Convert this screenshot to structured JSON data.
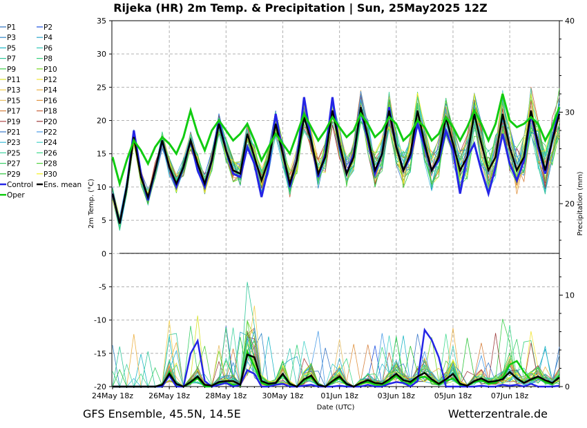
{
  "title": "Rijeka  (HR)  2m Temp. & Precipitation | Sun, 25May2025 12Z",
  "footer_left": "GFS Ensemble, 45.5N, 14.5E",
  "footer_right": "Wetterzentrale.de",
  "chart_data": {
    "type": "line",
    "title": "Rijeka  (HR)  2m Temp. & Precipitation | Sun, 25May2025 12Z",
    "xlabel": "Date (UTC)",
    "ylabel_left": "2m Temp. (°C)",
    "ylabel_right": "Precipitation (mm)",
    "ylim_left": [
      -20,
      35
    ],
    "ylim_right": [
      0,
      40
    ],
    "yticks_left": [
      "35",
      "30",
      "25",
      "20",
      "15",
      "10",
      "5",
      "0",
      "-5",
      "-10",
      "-15",
      "-20"
    ],
    "yticks_right": [
      "40",
      "30",
      "20",
      "10",
      "0"
    ],
    "xticks": [
      "24May 18z",
      "26May 18z",
      "28May 18z",
      "30May 18z",
      "01Jun 18z",
      "03Jun 18z",
      "05Jun 18z",
      "07Jun 18z"
    ],
    "x_step": "6h",
    "grid": true,
    "legend": "left outside",
    "legend_entries": [
      {
        "name": "P1",
        "color": "#2a6fbd"
      },
      {
        "name": "P2",
        "color": "#1a4fe0"
      },
      {
        "name": "P3",
        "color": "#2f86c8"
      },
      {
        "name": "P4",
        "color": "#2aa5c9"
      },
      {
        "name": "P5",
        "color": "#1cb6c6"
      },
      {
        "name": "P6",
        "color": "#2fc7b6"
      },
      {
        "name": "P7",
        "color": "#2fc79a"
      },
      {
        "name": "P8",
        "color": "#31d07a"
      },
      {
        "name": "P9",
        "color": "#3acd4a"
      },
      {
        "name": "P10",
        "color": "#74d822"
      },
      {
        "name": "P11",
        "color": "#d8e22a"
      },
      {
        "name": "P12",
        "color": "#f2e531"
      },
      {
        "name": "P13",
        "color": "#f2cf4f"
      },
      {
        "name": "P14",
        "color": "#ecb143"
      },
      {
        "name": "P15",
        "color": "#e8c067"
      },
      {
        "name": "P16",
        "color": "#e09340"
      },
      {
        "name": "P17",
        "color": "#d6813f"
      },
      {
        "name": "P18",
        "color": "#c7623e"
      },
      {
        "name": "P19",
        "color": "#b04a4a"
      },
      {
        "name": "P20",
        "color": "#9c3b3b"
      },
      {
        "name": "P21",
        "color": "#3a78c8"
      },
      {
        "name": "P22",
        "color": "#4a9be6"
      },
      {
        "name": "P23",
        "color": "#3bbbd8"
      },
      {
        "name": "P24",
        "color": "#47d2c8"
      },
      {
        "name": "P25",
        "color": "#41d4a0"
      },
      {
        "name": "P26",
        "color": "#3fd98c"
      },
      {
        "name": "P27",
        "color": "#39cf66"
      },
      {
        "name": "P28",
        "color": "#52d13e"
      },
      {
        "name": "P29",
        "color": "#2cc43a"
      },
      {
        "name": "P30",
        "color": "#f5f01c"
      },
      {
        "name": "Control",
        "color": "#2525e6"
      },
      {
        "name": "Ens. mean",
        "color": "#000000"
      },
      {
        "name": "Oper",
        "color": "#11cc11"
      }
    ],
    "series": [
      {
        "name": "Ens. mean",
        "axis": "left",
        "values": [
          9,
          4.5,
          10,
          17.5,
          11.5,
          8.5,
          12.5,
          17,
          13,
          10.5,
          13,
          17,
          13.5,
          10.5,
          14,
          19.5,
          15.5,
          12.5,
          12,
          18,
          14.5,
          11,
          14,
          19.5,
          15,
          10.5,
          14,
          20.5,
          17,
          12,
          14.5,
          21.5,
          16.5,
          12,
          14.5,
          22,
          17.5,
          12.5,
          15,
          21.5,
          16,
          12.5,
          15,
          21.5,
          16.5,
          12.5,
          14.5,
          20.5,
          16.5,
          12.5,
          14.5,
          21,
          16.5,
          12.5,
          14.5,
          21,
          16,
          12.5,
          14.5,
          21.5,
          16.5,
          12.5,
          17,
          21
        ]
      },
      {
        "name": "Control",
        "axis": "left",
        "values": [
          9,
          4.5,
          10,
          18.5,
          12,
          8,
          12.5,
          17,
          13,
          10,
          13,
          17,
          12.5,
          10,
          14,
          20,
          15.5,
          12,
          11.5,
          16,
          13.5,
          8.5,
          13,
          21,
          15,
          10,
          14,
          23.5,
          17,
          11.5,
          15,
          23.5,
          16,
          12,
          15,
          21.5,
          17,
          12,
          15,
          22,
          16,
          12.5,
          14.5,
          19.5,
          16,
          12.5,
          14,
          18.5,
          15.5,
          9,
          14.5,
          16.5,
          12.5,
          9,
          13,
          18,
          13.5,
          11,
          14,
          21,
          16,
          12,
          17,
          22
        ]
      },
      {
        "name": "Oper",
        "axis": "left",
        "values": [
          14.5,
          10.5,
          14,
          17,
          15.5,
          13.5,
          16,
          17.5,
          16.5,
          15,
          17.5,
          21.5,
          18,
          15.5,
          18.5,
          20,
          18.5,
          17,
          18,
          19.5,
          17,
          14,
          16,
          18,
          16.5,
          15,
          18,
          21,
          19,
          17,
          18.5,
          20.5,
          19,
          17.5,
          18.5,
          21,
          19.5,
          17.5,
          18.5,
          20.5,
          19.5,
          17,
          18,
          20,
          19,
          17,
          18,
          20.5,
          19,
          17,
          19,
          21.5,
          19.5,
          17,
          19.5,
          24,
          20,
          19,
          19.5,
          20.5,
          19.5,
          17,
          19,
          22
        ]
      },
      {
        "name": "Ens. mean precip",
        "axis": "right",
        "values": [
          0,
          0,
          0,
          0,
          0,
          0,
          0,
          0.2,
          1.4,
          0.3,
          0,
          0.5,
          1.1,
          0.2,
          0.1,
          0.5,
          0.6,
          0.6,
          0.2,
          3.5,
          3.2,
          0.6,
          0.3,
          0.4,
          1.4,
          0.3,
          0,
          0.8,
          1.2,
          0.2,
          0,
          0.6,
          1.1,
          0.3,
          0,
          0.4,
          0.7,
          0.4,
          0.3,
          0.8,
          1.4,
          0.7,
          0.5,
          1.1,
          1.5,
          0.8,
          0.3,
          0.8,
          1.4,
          0.3,
          0.1,
          0.6,
          0.9,
          0.5,
          0.6,
          0.8,
          1.6,
          0.9,
          0.4,
          0.8,
          1.1,
          0.7,
          0.4,
          1.0
        ]
      },
      {
        "name": "Control precip",
        "axis": "right",
        "values": [
          0,
          0,
          0,
          0,
          0,
          0,
          0,
          0,
          1.2,
          0,
          0,
          3.6,
          5.0,
          0.6,
          0,
          0.2,
          0.4,
          0,
          0.2,
          1.8,
          1.4,
          0,
          0,
          0.2,
          0.3,
          0,
          0,
          0.1,
          0.2,
          0,
          0,
          0,
          0.1,
          0,
          0,
          0,
          0.2,
          0,
          0,
          0.3,
          0.5,
          0.4,
          0,
          0.6,
          6.2,
          5.1,
          3.2,
          0,
          0,
          0,
          0,
          0,
          0.1,
          0,
          0,
          0.2,
          0.1,
          0.2,
          0,
          0.3,
          0,
          0,
          0,
          0.1
        ]
      },
      {
        "name": "Oper precip",
        "axis": "right",
        "values": [
          0,
          0,
          0,
          0,
          0,
          0,
          0,
          0,
          1.6,
          0.2,
          0,
          0.4,
          0.9,
          0,
          0,
          0.3,
          0.4,
          0.2,
          0.1,
          3.8,
          2.2,
          0.4,
          0.1,
          0.3,
          1.3,
          0.2,
          0,
          0.7,
          1.0,
          0.1,
          0,
          0.5,
          0.9,
          0.2,
          0,
          0.3,
          0.5,
          0.2,
          0.1,
          0.6,
          1.2,
          0.4,
          0.3,
          0.9,
          1.1,
          0.6,
          0.2,
          0.6,
          0.9,
          0.2,
          0.1,
          0.5,
          0.7,
          0.3,
          0.4,
          1.0,
          2.4,
          2.8,
          1.6,
          0.7,
          1.0,
          0.5,
          0.3,
          1.2
        ]
      }
    ]
  }
}
